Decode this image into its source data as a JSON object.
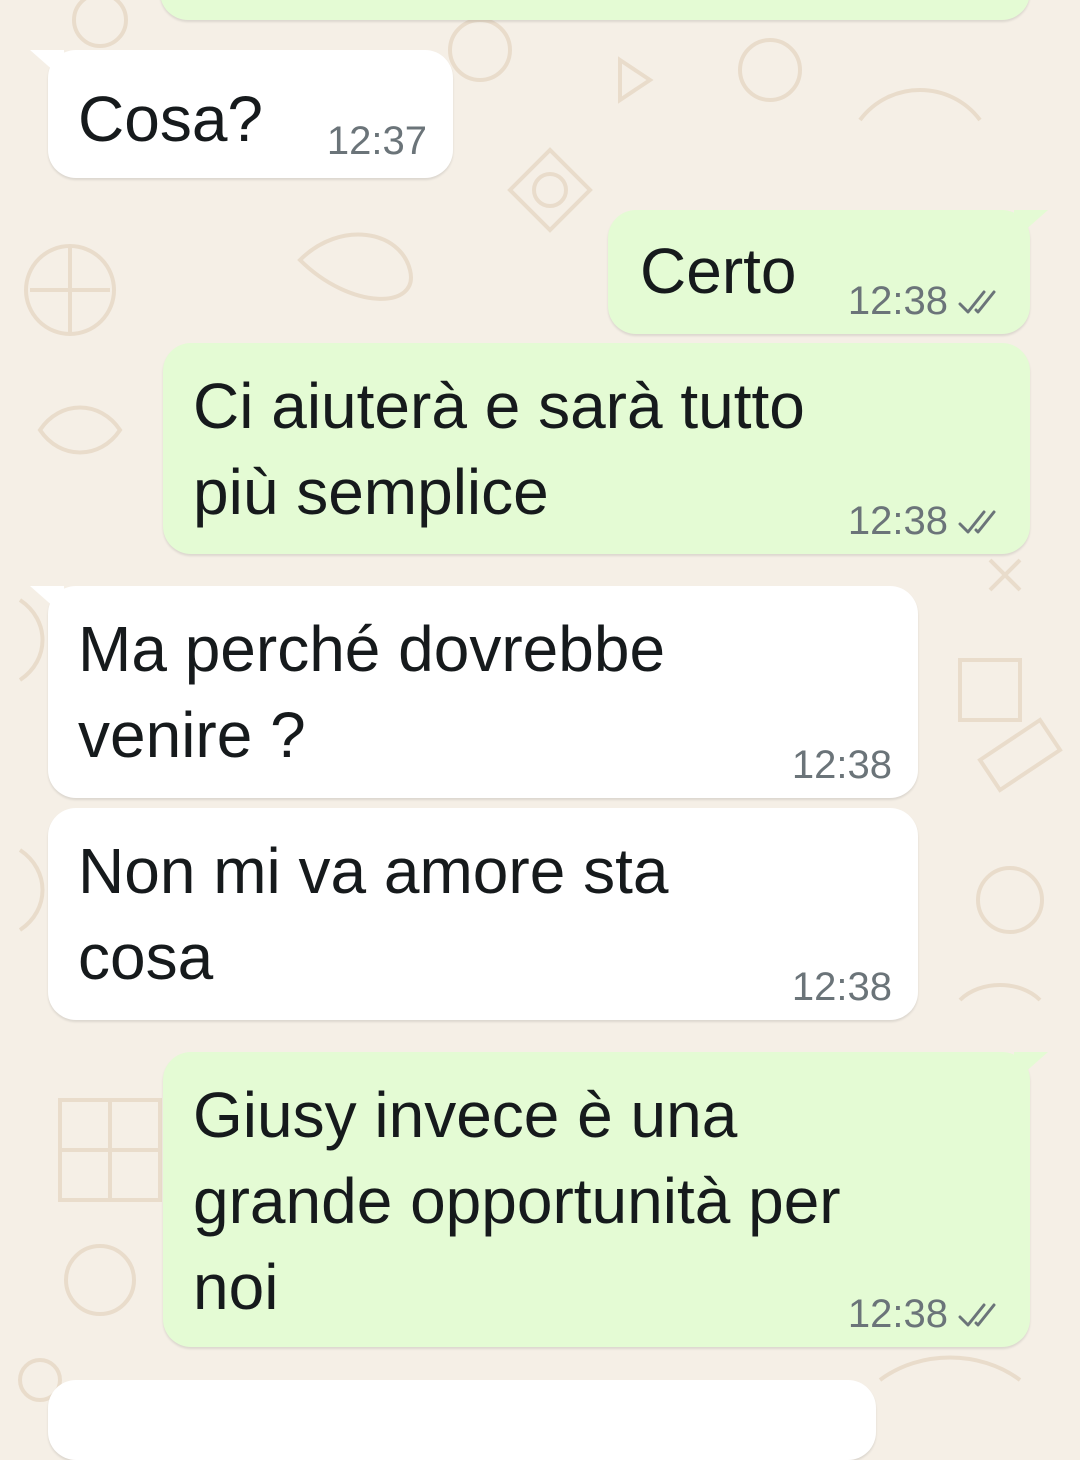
{
  "chat": {
    "messages": [
      {
        "text": "Cosa?",
        "time": "12:37",
        "dir": "in"
      },
      {
        "text": "Certo",
        "time": "12:38",
        "dir": "out",
        "status": "read"
      },
      {
        "text": "Ci aiuterà e sarà tutto\npiù semplice",
        "time": "12:38",
        "dir": "out",
        "status": "read"
      },
      {
        "text": "Ma perché dovrebbe\nvenire ?",
        "time": "12:38",
        "dir": "in"
      },
      {
        "text": "Non mi va amore sta\ncosa",
        "time": "12:38",
        "dir": "in"
      },
      {
        "text": "Giusy invece è una\ngrande opportunità per\nnoi",
        "time": "12:38",
        "dir": "out",
        "status": "read"
      }
    ],
    "colors": {
      "wallpaper": "#f5efe6",
      "incoming_bubble": "#ffffff",
      "outgoing_bubble": "#e4fbd4",
      "message_text": "#161a1c",
      "timestamp": "#6b7479"
    },
    "icons": {
      "read_status": "double-check-icon",
      "wallpaper": "doodle-pattern"
    }
  }
}
